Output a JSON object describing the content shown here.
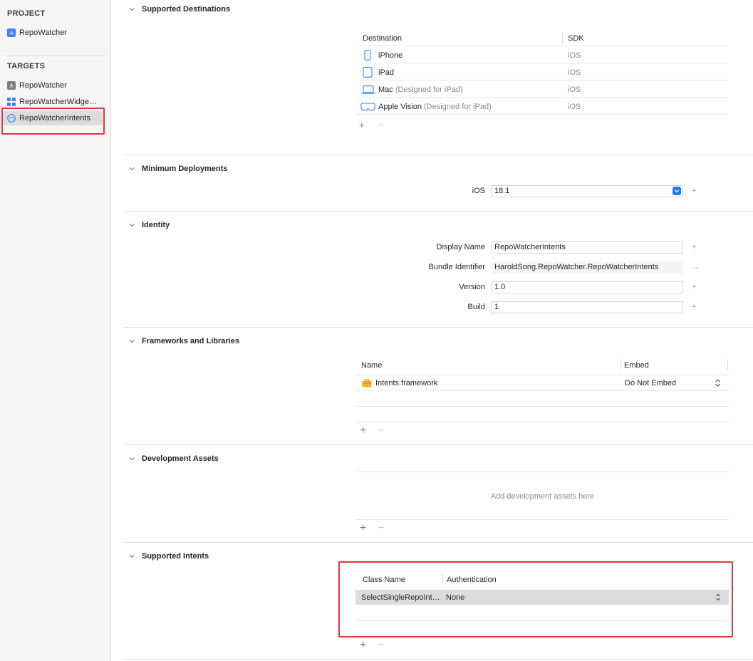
{
  "sidebar": {
    "project_header": "PROJECT",
    "project_item": "RepoWatcher",
    "targets_header": "TARGETS",
    "targets": [
      {
        "label": "RepoWatcher",
        "icon": "app-target-icon"
      },
      {
        "label": "RepoWatcherWidge…",
        "icon": "widget-target-icon"
      },
      {
        "label": "RepoWatcherIntents",
        "icon": "intents-target-icon",
        "selected": true
      }
    ]
  },
  "destinations": {
    "title": "Supported Destinations",
    "col_destination": "Destination",
    "col_sdk": "SDK",
    "rows": [
      {
        "name": "iPhone",
        "note": "",
        "sdk": "iOS",
        "icon": "iphone-icon"
      },
      {
        "name": "iPad",
        "note": "",
        "sdk": "iOS",
        "icon": "ipad-icon"
      },
      {
        "name": "Mac",
        "note": "(Designed for iPad)",
        "sdk": "iOS",
        "icon": "mac-icon"
      },
      {
        "name": "Apple Vision",
        "note": "(Designed for iPad)",
        "sdk": "iOS",
        "icon": "vision-icon"
      }
    ],
    "add": "+",
    "remove": "−"
  },
  "deployments": {
    "title": "Minimum Deployments",
    "label": "iOS",
    "value": "18.1",
    "plus": "+"
  },
  "identity": {
    "title": "Identity",
    "display_name_label": "Display Name",
    "display_name": "RepoWatcherIntents",
    "bundle_id_label": "Bundle Identifier",
    "bundle_id": "HaroldSong.RepoWatcher.RepoWatcherIntents",
    "version_label": "Version",
    "version": "1.0",
    "build_label": "Build",
    "build": "1",
    "plus": "+",
    "arrow": "→"
  },
  "frameworks": {
    "title": "Frameworks and Libraries",
    "col_name": "Name",
    "col_embed": "Embed",
    "rows": [
      {
        "name": "Intents.framework",
        "embed": "Do Not Embed",
        "icon": "framework-icon"
      }
    ],
    "add": "+",
    "remove": "−"
  },
  "dev_assets": {
    "title": "Development Assets",
    "placeholder": "Add development assets here",
    "add": "+",
    "remove": "−"
  },
  "intents": {
    "title": "Supported Intents",
    "col_class": "Class Name",
    "col_auth": "Authentication",
    "rows": [
      {
        "class_name": "SelectSingleRepoInt…",
        "auth": "None"
      }
    ],
    "add": "+",
    "remove": "−"
  },
  "colors": {
    "highlight": "#e8353d",
    "accent": "#1f7cf0"
  }
}
